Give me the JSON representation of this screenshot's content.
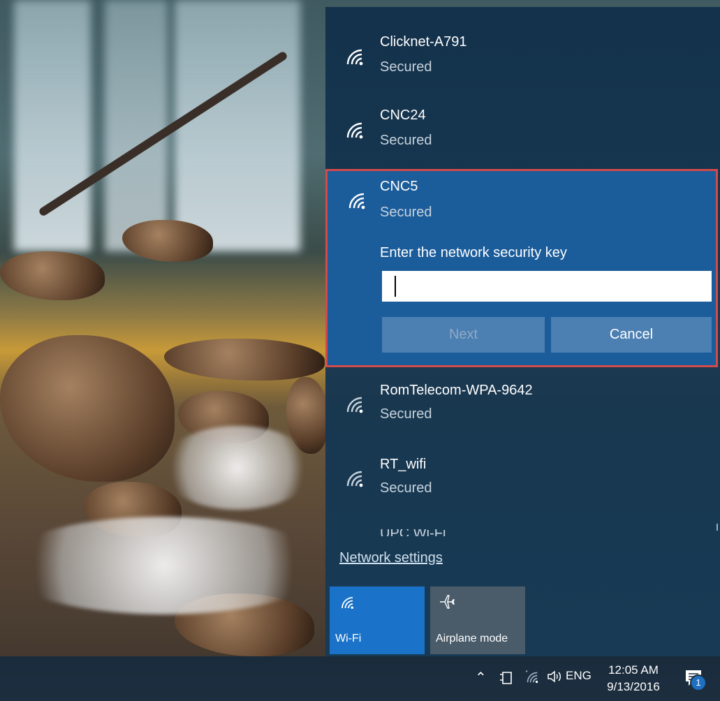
{
  "networks": [
    {
      "ssid": "Clicknet-A791",
      "status": "Secured"
    },
    {
      "ssid": "CNC24",
      "status": "Secured"
    },
    {
      "ssid": "CNC5",
      "status": "Secured"
    },
    {
      "ssid": "RomTelecom-WPA-9642",
      "status": "Secured"
    },
    {
      "ssid": "RT_wifi",
      "status": "Secured"
    },
    {
      "ssid": "UPC Wi-Fi",
      "status": ""
    }
  ],
  "connect": {
    "prompt": "Enter the network security key",
    "key_value": "",
    "next_label": "Next",
    "cancel_label": "Cancel"
  },
  "network_settings_label": "Network settings",
  "quick_actions": {
    "wifi_label": "Wi-Fi",
    "airplane_label": "Airplane mode"
  },
  "taskbar": {
    "language": "ENG",
    "time": "12:05 AM",
    "date": "9/13/2016",
    "notification_count": "1"
  },
  "colors": {
    "selected_bg": "#1b5c9a",
    "highlight_border": "#d24a4a",
    "wifi_tile": "#1a73c8"
  }
}
